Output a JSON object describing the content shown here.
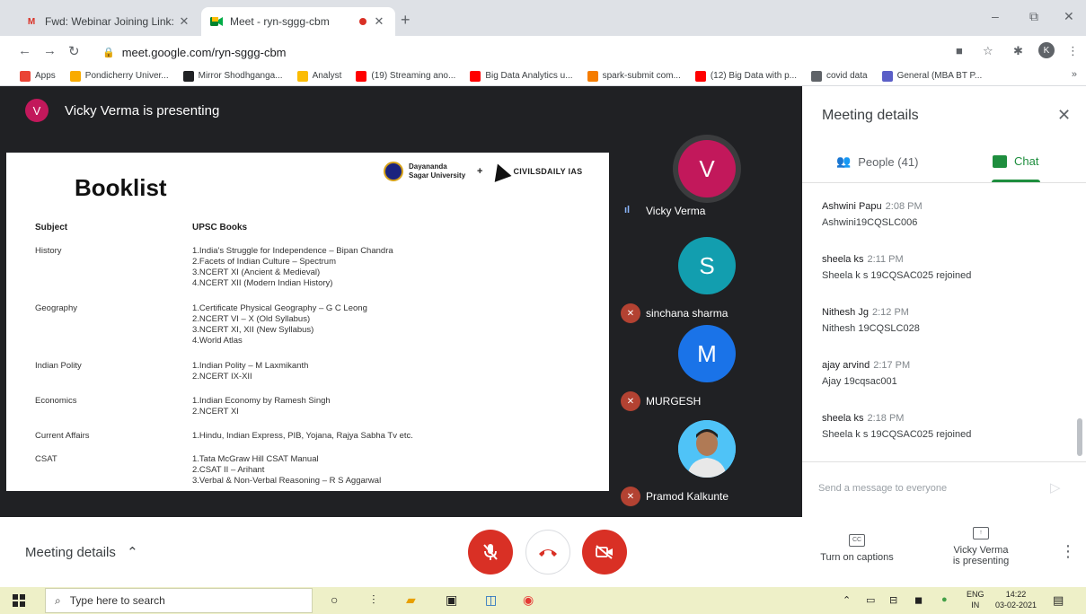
{
  "browser": {
    "tabs": [
      {
        "title": "Fwd: Webinar Joining Link: How t",
        "favicon": "gmail-icon",
        "close": "✕"
      },
      {
        "title": "Meet - ryn-sggg-cbm",
        "favicon": "meet-icon",
        "close": "✕"
      }
    ],
    "new_tab": "+",
    "window_controls": {
      "minimize": "–",
      "restore": "⧉",
      "close": "✕"
    },
    "url": "meet.google.com/ryn-sggg-cbm",
    "profile_initial": "K",
    "bookmarks": [
      {
        "label": "Apps",
        "color": "#ea4335"
      },
      {
        "label": "Pondicherry Univer...",
        "color": "#f9ab00"
      },
      {
        "label": "Mirror Shodhganga...",
        "color": "#202124"
      },
      {
        "label": "Analyst",
        "color": "#fbbc04"
      },
      {
        "label": "(19) Streaming ano...",
        "color": "#ff0000"
      },
      {
        "label": "Big Data Analytics u...",
        "color": "#ff0000"
      },
      {
        "label": "spark-submit com...",
        "color": "#f57c00"
      },
      {
        "label": "(12) Big Data with p...",
        "color": "#ff0000"
      },
      {
        "label": "covid data",
        "color": "#5f6368"
      },
      {
        "label": "General (MBA BT P...",
        "color": "#5b5fc7"
      }
    ],
    "bookmarks_more": "»"
  },
  "presenter": {
    "initial": "V",
    "text": "Vicky Verma is presenting",
    "avatar_color": "#c2185b"
  },
  "slide": {
    "title": "Booklist",
    "logo_left": "Dayananda Sagar University",
    "logo_plus": "+",
    "logo_right": "CIVILSDAILY IAS",
    "col_subject": "Subject",
    "col_books": "UPSC Books",
    "rows": [
      {
        "subject": "History",
        "books": [
          "1.India's Struggle for Independence – Bipan Chandra",
          "2.Facets of Indian Culture – Spectrum",
          "3.NCERT XI (Ancient & Medieval)",
          "4.NCERT XII (Modern Indian History)"
        ]
      },
      {
        "subject": "Geography",
        "books": [
          "1.Certificate Physical Geography – G C Leong",
          "2.NCERT VI – X (Old Syllabus)",
          "3.NCERT XI, XII (New Syllabus)",
          "4.World Atlas"
        ]
      },
      {
        "subject": "Indian Polity",
        "books": [
          "1.Indian Polity – M Laxmikanth",
          "2.NCERT IX-XII"
        ]
      },
      {
        "subject": "Economics",
        "books": [
          "1.Indian Economy by Ramesh Singh",
          "2.NCERT XI"
        ]
      },
      {
        "subject": "Current Affairs",
        "books": [
          "1.Hindu, Indian Express, PIB, Yojana, Rajya Sabha Tv etc."
        ]
      },
      {
        "subject": "CSAT",
        "books": [
          "1.Tata McGraw Hill CSAT Manual",
          "2.CSAT II – Arihant",
          "3.Verbal & Non-Verbal Reasoning – R S Aggarwal"
        ]
      }
    ]
  },
  "participants": [
    {
      "name": "Vicky Verma",
      "initial": "V",
      "color": "#c2185b",
      "muted": false
    },
    {
      "name": "sinchana sharma",
      "initial": "S",
      "color": "#129eaf",
      "muted": true
    },
    {
      "name": "MURGESH",
      "initial": "M",
      "color": "#1a73e8",
      "muted": true
    },
    {
      "name": "Pramod Kalkunte",
      "initial": "",
      "color": "#4fc3f7",
      "muted": true
    }
  ],
  "panel": {
    "title": "Meeting details",
    "close": "✕",
    "people_tab": "People (41)",
    "chat_tab": "Chat",
    "messages": [
      {
        "sender": "Ashwini Papu",
        "time": "2:08 PM",
        "text": "Ashwini19CQSLC006"
      },
      {
        "sender": "sheela ks",
        "time": "2:11 PM",
        "text": "Sheela k s 19CQSAC025 rejoined"
      },
      {
        "sender": "Nithesh Jg",
        "time": "2:12 PM",
        "text": "Nithesh 19CQSLC028"
      },
      {
        "sender": "ajay arvind",
        "time": "2:17 PM",
        "text": "Ajay 19cqsac001"
      },
      {
        "sender": "sheela ks",
        "time": "2:18 PM",
        "text": "Sheela k s 19CQSAC025 rejoined"
      }
    ],
    "compose_placeholder": "Send a message to everyone"
  },
  "controls": {
    "meeting_details": "Meeting details",
    "captions_icon": "CC",
    "captions_label": "Turn on captions",
    "presenting_line1": "Vicky Verma",
    "presenting_line2": "is presenting"
  },
  "taskbar": {
    "search_placeholder": "Type here to search",
    "lang_line1": "ENG",
    "lang_line2": "IN",
    "time": "14:22",
    "date": "03-02-2021"
  },
  "colors": {
    "meet_red": "#d93025",
    "chat_green": "#1e8e3e",
    "stage_bg": "#202124"
  }
}
